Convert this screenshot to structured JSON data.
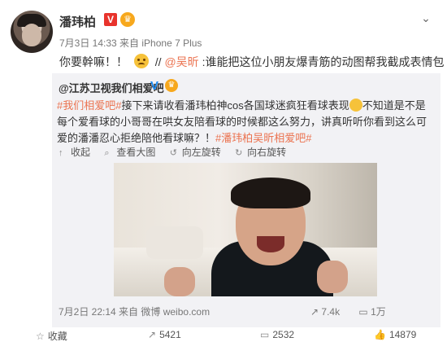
{
  "header": {
    "author": "潘玮柏",
    "vip_badge": "V",
    "meta": "7月3日 14:33 来自 iPhone 7 Plus",
    "more_icon": "chevron-down-icon"
  },
  "post": {
    "text_before": "你要幹嘛！！",
    "text_slashes": "//",
    "mention": "@吴昕",
    "text_after": ":谁能把这位小朋友爆青筋的动图帮我截成表情包"
  },
  "repost": {
    "user": "@江苏卫视我们相爱吧",
    "v_badge": "V",
    "tag1": "#我们相爱吧#",
    "body1": "接下来请收看潘玮柏神cos各国球迷疯狂看球表现",
    "body2": "不知道是不是每个爱看球的小哥哥在哄女友陪看球的时候都这么努力，讲真听听你看到这么可爱的潘潘忍心拒绝陪他看球嘛？！",
    "tag2": "#潘玮柏吴昕相爱吧#",
    "actions": [
      {
        "icon": "collapse-icon",
        "label": "收起"
      },
      {
        "icon": "zoom-icon",
        "label": "查看大图"
      },
      {
        "icon": "rotate-left-icon",
        "label": "向左旋转"
      },
      {
        "icon": "rotate-right-icon",
        "label": "向右旋转"
      }
    ],
    "footer": "7月2日 22:14 来自 微博 weibo.com",
    "repost_count": "7.4k",
    "comment_count": "1万"
  },
  "bottom_bar": {
    "favorite": "收藏",
    "share": "5421",
    "comment": "2532",
    "like": "14879"
  },
  "colors": {
    "link": "#eb7350",
    "vip": "#e8332c",
    "verified": "#1e8cf2"
  }
}
